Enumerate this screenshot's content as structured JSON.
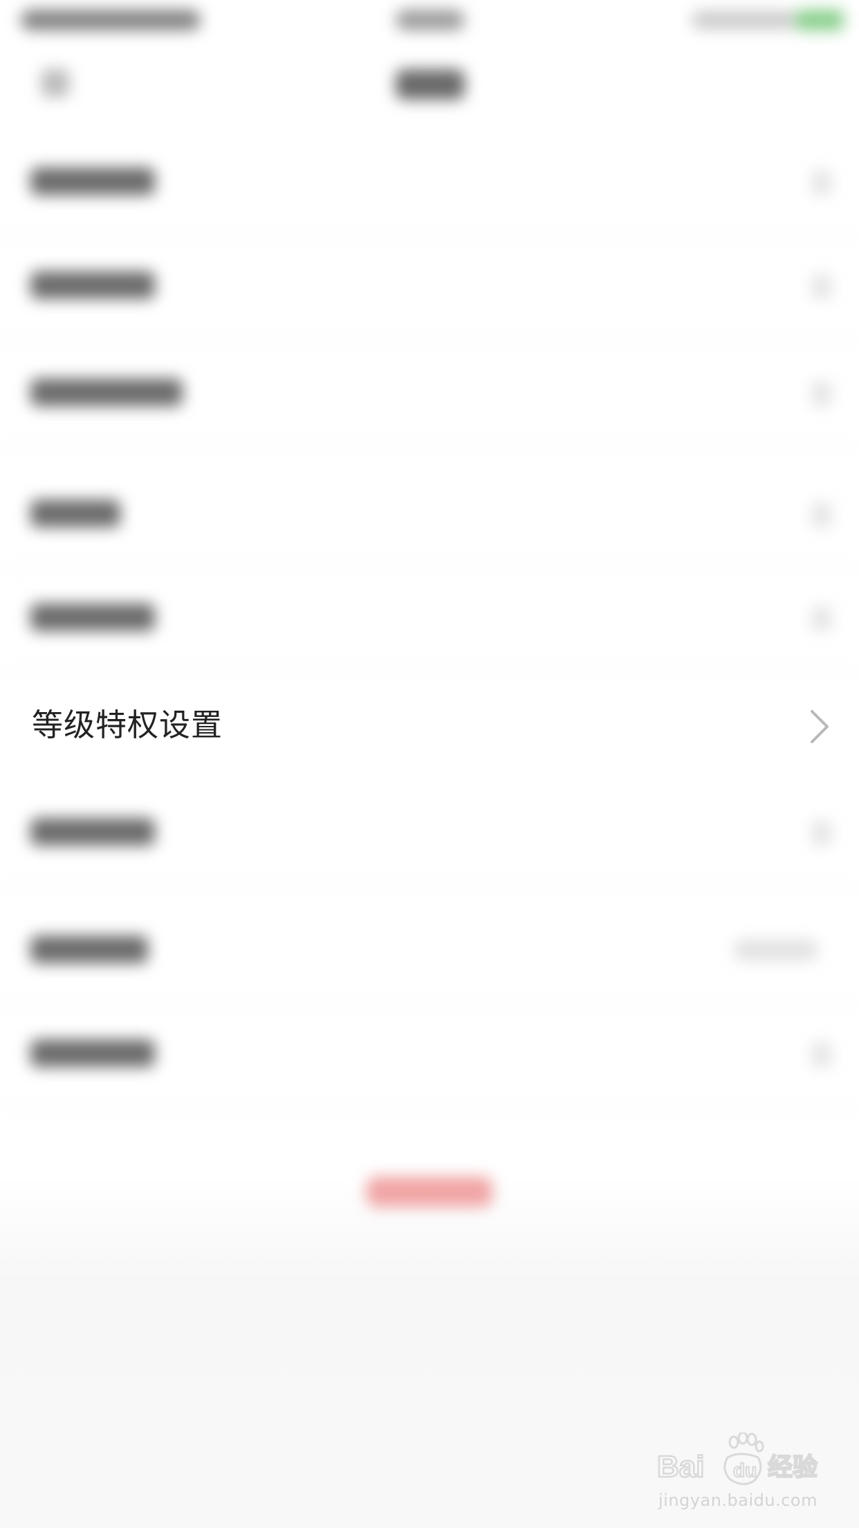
{
  "settings": {
    "highlighted_item": {
      "label": "等级特权设置"
    }
  },
  "watermark": {
    "logo_text": "Baidu经验",
    "url": "jingyan.baidu.com"
  },
  "colors": {
    "battery": "#6cc36f",
    "logout_button": "#e55a5a",
    "text": "#222222",
    "chevron": "#b8b8b8"
  }
}
